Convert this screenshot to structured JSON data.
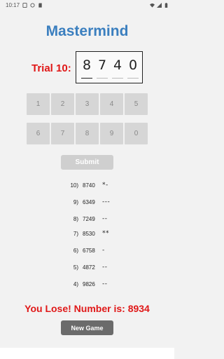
{
  "status_bar": {
    "time": "10:17",
    "icons": [
      "sim-icon",
      "notification-icon",
      "sd-icon",
      "wifi-icon",
      "signal-icon",
      "battery-icon"
    ]
  },
  "title": "Mastermind",
  "trial": {
    "label": "Trial 10:",
    "digits": [
      "8",
      "7",
      "4",
      "0"
    ]
  },
  "keypad": {
    "row1": [
      "1",
      "2",
      "3",
      "4",
      "5"
    ],
    "row2": [
      "6",
      "7",
      "8",
      "9",
      "0"
    ]
  },
  "submit_label": "Submit",
  "history": [
    {
      "index": "10)",
      "guess": "8740",
      "result": "*-"
    },
    {
      "index": "9)",
      "guess": "6349",
      "result": "---"
    },
    {
      "index": "8)",
      "guess": "7249",
      "result": "--"
    },
    {
      "index": "7)",
      "guess": "8530",
      "result": "**"
    },
    {
      "index": "6)",
      "guess": "6758",
      "result": "-"
    },
    {
      "index": "5)",
      "guess": "4872",
      "result": "--"
    },
    {
      "index": "4)",
      "guess": "9826",
      "result": "--"
    }
  ],
  "result_message": "You Lose! Number is: 8934",
  "new_game_label": "New Game",
  "colors": {
    "title": "#3b7fbf",
    "alert": "#e01818",
    "keypad_disabled": "#d6d6d6",
    "new_game_bg": "#6b6b6b"
  }
}
